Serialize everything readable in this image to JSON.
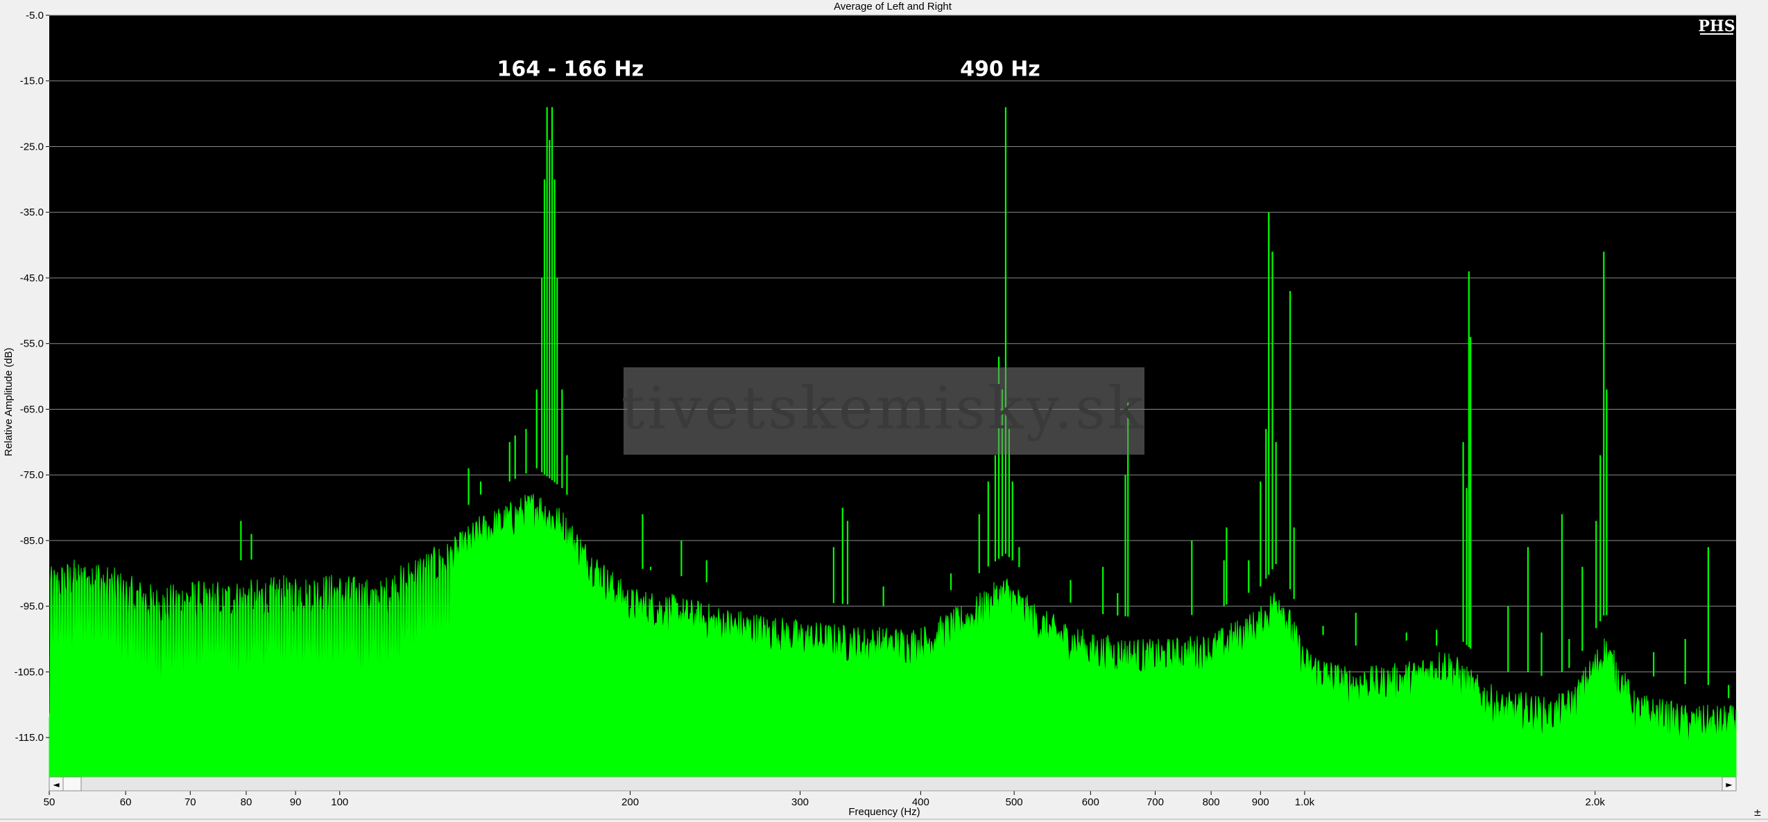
{
  "window": {
    "title": "Average of Left and Right",
    "logo": "PHS",
    "watermark": "tivetskemisky.sk"
  },
  "colors": {
    "plot_background": "#000000",
    "spectrum": "#00ff00",
    "grid": "#8a8a8a",
    "peak_label": "#ffffff"
  },
  "scrollbar": {
    "left_arrow": "◄",
    "right_arrow": "►",
    "corner_glyph": "±"
  },
  "chart_data": {
    "type": "area",
    "title": "Average of Left and Right",
    "xlabel": "Frequency (Hz)",
    "ylabel": "Relative Amplitude (dB)",
    "xscale": "log",
    "xlim": [
      50,
      2800
    ],
    "ylim": [
      -121,
      -5
    ],
    "grid": true,
    "y_ticks": [
      -5,
      -15,
      -25,
      -35,
      -45,
      -55,
      -65,
      -75,
      -85,
      -95,
      -105,
      -115
    ],
    "y_tick_labels": [
      "-5.0",
      "-15.0",
      "-25.0",
      "-35.0",
      "-45.0",
      "-55.0",
      "-65.0",
      "-75.0",
      "-85.0",
      "-95.0",
      "-105.0",
      "-115.0"
    ],
    "x_ticks": [
      50,
      60,
      70,
      80,
      90,
      100,
      200,
      300,
      400,
      500,
      600,
      700,
      800,
      900,
      1000,
      2000
    ],
    "x_tick_labels": [
      "50",
      "60",
      "70",
      "80",
      "90",
      "100",
      "200",
      "300",
      "400",
      "500",
      "600",
      "700",
      "800",
      "900",
      "1.0k",
      "2.0k"
    ],
    "annotations": [
      {
        "text": "164 - 166 Hz",
        "x": 165,
        "y": -19
      },
      {
        "text": "490 Hz",
        "x": 490,
        "y": -19
      }
    ],
    "floor": [
      [
        50,
        -92
      ],
      [
        55,
        -90
      ],
      [
        60,
        -93
      ],
      [
        65,
        -95
      ],
      [
        70,
        -94
      ],
      [
        80,
        -94
      ],
      [
        90,
        -93
      ],
      [
        100,
        -93
      ],
      [
        110,
        -94
      ],
      [
        120,
        -90
      ],
      [
        130,
        -88
      ],
      [
        140,
        -84
      ],
      [
        150,
        -82
      ],
      [
        160,
        -80
      ],
      [
        170,
        -83
      ],
      [
        180,
        -88
      ],
      [
        190,
        -92
      ],
      [
        200,
        -95
      ],
      [
        220,
        -96
      ],
      [
        250,
        -98
      ],
      [
        300,
        -100
      ],
      [
        350,
        -101
      ],
      [
        400,
        -101
      ],
      [
        450,
        -97
      ],
      [
        490,
        -93
      ],
      [
        530,
        -98
      ],
      [
        600,
        -102
      ],
      [
        700,
        -103
      ],
      [
        800,
        -102
      ],
      [
        900,
        -98
      ],
      [
        940,
        -94
      ],
      [
        1000,
        -104
      ],
      [
        1100,
        -107
      ],
      [
        1200,
        -107
      ],
      [
        1300,
        -106
      ],
      [
        1400,
        -104
      ],
      [
        1500,
        -108
      ],
      [
        1600,
        -111
      ],
      [
        1700,
        -111
      ],
      [
        1800,
        -112
      ],
      [
        1900,
        -110
      ],
      [
        2050,
        -102
      ],
      [
        2200,
        -111
      ],
      [
        2500,
        -113
      ],
      [
        2800,
        -113
      ]
    ],
    "peaks": [
      {
        "f": 79,
        "y": -82
      },
      {
        "f": 81,
        "y": -84
      },
      {
        "f": 136,
        "y": -74
      },
      {
        "f": 140,
        "y": -76
      },
      {
        "f": 150,
        "y": -70
      },
      {
        "f": 152,
        "y": -69
      },
      {
        "f": 156,
        "y": -68
      },
      {
        "f": 160,
        "y": -62
      },
      {
        "f": 162,
        "y": -45
      },
      {
        "f": 163,
        "y": -30
      },
      {
        "f": 164,
        "y": -19
      },
      {
        "f": 165,
        "y": -24
      },
      {
        "f": 166,
        "y": -19
      },
      {
        "f": 167,
        "y": -30
      },
      {
        "f": 168,
        "y": -45
      },
      {
        "f": 170,
        "y": -62
      },
      {
        "f": 172,
        "y": -72
      },
      {
        "f": 206,
        "y": -81
      },
      {
        "f": 210,
        "y": -89
      },
      {
        "f": 226,
        "y": -85
      },
      {
        "f": 240,
        "y": -88
      },
      {
        "f": 332,
        "y": -80
      },
      {
        "f": 336,
        "y": -82
      },
      {
        "f": 325,
        "y": -86
      },
      {
        "f": 366,
        "y": -92
      },
      {
        "f": 430,
        "y": -90
      },
      {
        "f": 460,
        "y": -81
      },
      {
        "f": 470,
        "y": -76
      },
      {
        "f": 478,
        "y": -72
      },
      {
        "f": 482,
        "y": -57
      },
      {
        "f": 486,
        "y": -62
      },
      {
        "f": 490,
        "y": -19
      },
      {
        "f": 494,
        "y": -68
      },
      {
        "f": 498,
        "y": -76
      },
      {
        "f": 506,
        "y": -86
      },
      {
        "f": 572,
        "y": -91
      },
      {
        "f": 618,
        "y": -89
      },
      {
        "f": 640,
        "y": -93
      },
      {
        "f": 652,
        "y": -75
      },
      {
        "f": 656,
        "y": -64
      },
      {
        "f": 764,
        "y": -85
      },
      {
        "f": 825,
        "y": -88
      },
      {
        "f": 830,
        "y": -83
      },
      {
        "f": 875,
        "y": -88
      },
      {
        "f": 900,
        "y": -76
      },
      {
        "f": 912,
        "y": -68
      },
      {
        "f": 918,
        "y": -35
      },
      {
        "f": 926,
        "y": -41
      },
      {
        "f": 934,
        "y": -70
      },
      {
        "f": 966,
        "y": -47
      },
      {
        "f": 975,
        "y": -83
      },
      {
        "f": 1045,
        "y": -98
      },
      {
        "f": 1130,
        "y": -96
      },
      {
        "f": 1275,
        "y": -99
      },
      {
        "f": 1370,
        "y": -101
      },
      {
        "f": 1460,
        "y": -70
      },
      {
        "f": 1472,
        "y": -77
      },
      {
        "f": 1480,
        "y": -44
      },
      {
        "f": 1486,
        "y": -54
      },
      {
        "f": 1625,
        "y": -95
      },
      {
        "f": 1704,
        "y": -86
      },
      {
        "f": 1760,
        "y": -99
      },
      {
        "f": 1848,
        "y": -81
      },
      {
        "f": 1880,
        "y": -100
      },
      {
        "f": 1940,
        "y": -89
      },
      {
        "f": 2005,
        "y": -82
      },
      {
        "f": 2025,
        "y": -72
      },
      {
        "f": 2042,
        "y": -41
      },
      {
        "f": 2056,
        "y": -62
      },
      {
        "f": 2300,
        "y": -102
      },
      {
        "f": 2480,
        "y": -100
      },
      {
        "f": 2620,
        "y": -86
      },
      {
        "f": 2750,
        "y": -109
      }
    ]
  }
}
